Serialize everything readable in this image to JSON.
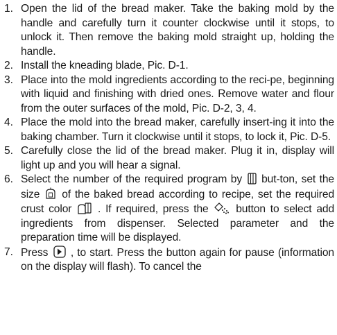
{
  "steps": [
    {
      "num": "1.",
      "text": "Open the lid of the bread maker. Take the baking mold by the handle and carefully turn it counter clockwise until it stops, to unlock it. Then remove the baking mold straight up, holding the handle."
    },
    {
      "num": "2.",
      "text": "Install the kneading blade, Pic. D-1."
    },
    {
      "num": "3.",
      "text": "Place into the mold ingredients according to the reci-pe, beginning with liquid and finishing with dried ones. Remove water and flour from the outer surfaces of the mold, Pic. D-2, 3, 4."
    },
    {
      "num": "4.",
      "text": "Place the mold into the bread maker, carefully insert-ing it into the baking chamber. Turn it clockwise until it stops, to lock it, Pic. D-5."
    },
    {
      "num": "5.",
      "text": "Carefully close the lid of the bread maker. Plug it in, display will light up and you will hear a signal."
    },
    {
      "num": "6.",
      "t1": "Select the number of the required program by",
      "t2": "but-ton, set the size",
      "t3": "of the baked bread according to recipe, set the required crust color",
      "t4": ". If required, press the",
      "t5": "button to select add ingredients from dispenser. Selected parameter and the preparation time will be displayed."
    },
    {
      "num": "7.",
      "t1": "Press",
      "t2": ", to start. Press the button again for pause (information on the display will flash). To cancel the"
    }
  ],
  "icons": {
    "menu": "menu-button-icon",
    "size": "loaf-size-icon",
    "crust": "crust-color-icon",
    "dispenser": "dispenser-icon",
    "start": "start-pause-icon"
  }
}
